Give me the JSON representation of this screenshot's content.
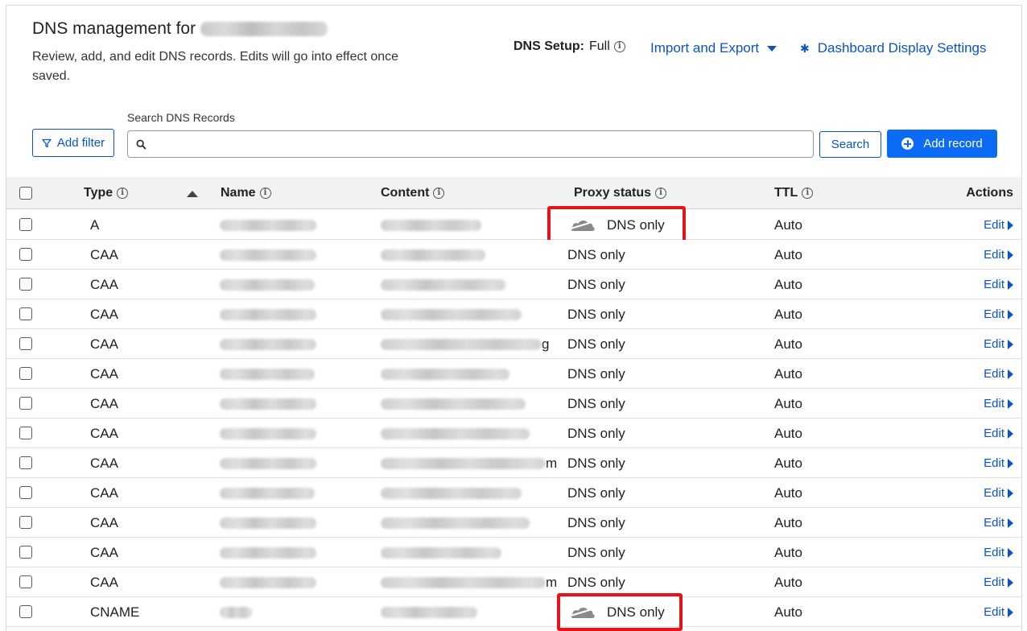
{
  "header": {
    "title": "DNS management for",
    "subtitle": "Review, add, and edit DNS records. Edits will go into effect once saved.",
    "dns_setup_label": "DNS Setup:",
    "dns_setup_value": "Full",
    "import_export": "Import and Export",
    "dashboard_settings": "Dashboard Display Settings"
  },
  "toolbar": {
    "add_filter": "Add filter",
    "search_label": "Search DNS Records",
    "search_value": "",
    "search_button": "Search",
    "add_record": "Add record"
  },
  "table": {
    "columns": {
      "type": "Type",
      "name": "Name",
      "content": "Content",
      "proxy": "Proxy status",
      "ttl": "TTL",
      "actions": "Actions"
    },
    "sort": {
      "column": "Type",
      "direction": "ascending"
    },
    "edit_label": "Edit",
    "rows": [
      {
        "type": "A",
        "proxy": "DNS only",
        "ttl": "Auto",
        "cloud_icon": true
      },
      {
        "type": "CAA",
        "proxy": "DNS only",
        "ttl": "Auto"
      },
      {
        "type": "CAA",
        "proxy": "DNS only",
        "ttl": "Auto"
      },
      {
        "type": "CAA",
        "proxy": "DNS only",
        "ttl": "Auto"
      },
      {
        "type": "CAA",
        "proxy": "DNS only",
        "ttl": "Auto",
        "content_tail": "g"
      },
      {
        "type": "CAA",
        "proxy": "DNS only",
        "ttl": "Auto"
      },
      {
        "type": "CAA",
        "proxy": "DNS only",
        "ttl": "Auto"
      },
      {
        "type": "CAA",
        "proxy": "DNS only",
        "ttl": "Auto"
      },
      {
        "type": "CAA",
        "proxy": "DNS only",
        "ttl": "Auto",
        "content_tail": "m"
      },
      {
        "type": "CAA",
        "proxy": "DNS only",
        "ttl": "Auto"
      },
      {
        "type": "CAA",
        "proxy": "DNS only",
        "ttl": "Auto"
      },
      {
        "type": "CAA",
        "proxy": "DNS only",
        "ttl": "Auto"
      },
      {
        "type": "CAA",
        "proxy": "DNS only",
        "ttl": "Auto",
        "content_tail": "m"
      },
      {
        "type": "CNAME",
        "proxy": "DNS only",
        "ttl": "Auto",
        "cloud_icon": true
      }
    ]
  },
  "colors": {
    "link": "#0b54c4",
    "primary_button": "#0b6bf5",
    "highlight": "#e8121b",
    "header_bg": "#f2f2f2"
  }
}
